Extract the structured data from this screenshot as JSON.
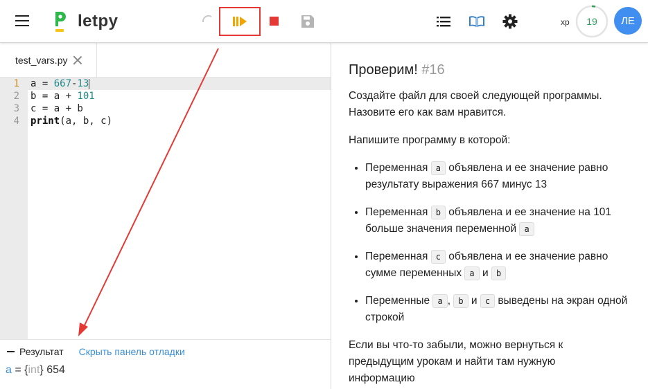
{
  "header": {
    "logo_text": "letpy",
    "xp_label": "xp",
    "xp_value": "19",
    "avatar_initials": "ЛЕ",
    "accent_color": "#f0a500",
    "highlight_color": "#e53935"
  },
  "editor": {
    "tab_name": "test_vars.py",
    "line_numbers": [
      "1",
      "2",
      "3",
      "4"
    ],
    "lines": {
      "l1": {
        "v": "a",
        "op": " = ",
        "n1": "667",
        "minus": "-",
        "n2": "13"
      },
      "l2": {
        "v": "b",
        "op": " = ",
        "mid": "a + ",
        "n": "101"
      },
      "l3": {
        "text": "c = a + b"
      },
      "l4": {
        "kw": "print",
        "rest": "(a, b, c)"
      }
    }
  },
  "debug": {
    "result_label": "Результат",
    "hide_link": "Скрыть панель отладки",
    "var_name": "a",
    "eq": " = {",
    "type": "int",
    "close": "} ",
    "value": "654"
  },
  "lesson": {
    "title": "Проверим!",
    "number": "#16",
    "intro": "Создайте файл для своей следующей программы. Назовите его как вам нравится.",
    "task_intro": "Напишите программу в которой:",
    "t1": {
      "a": "Переменная",
      "c1": "a",
      "b": "объявлена и ее значение равно результату выражения 667 минус 13"
    },
    "t2": {
      "a": "Переменная",
      "c1": "b",
      "b": "объявлена и ее значение на 101 больше значения переменной",
      "c2": "a"
    },
    "t3": {
      "a": "Переменная",
      "c1": "c",
      "b": "объявлена и ее значение равно сумме переменных",
      "c2": "a",
      "and": "и",
      "c3": "b"
    },
    "t4": {
      "a": "Переменные",
      "c1": "a",
      "sep": ",",
      "c2": "b",
      "and": "и",
      "c3": "c",
      "b": "выведены на экран одной строкой"
    },
    "outro": "Если вы что-то забыли, можно вернуться к предыдущим урокам и найти там нужную информацию"
  }
}
